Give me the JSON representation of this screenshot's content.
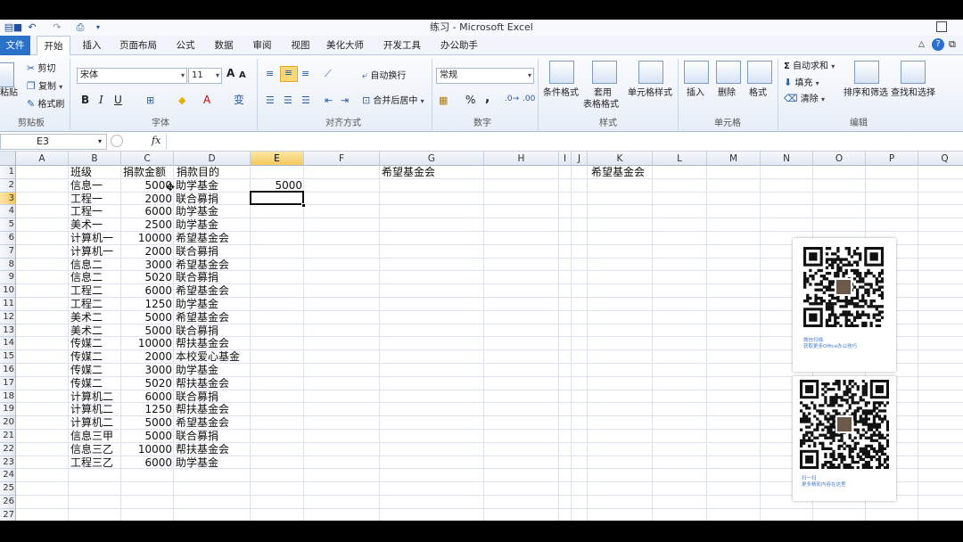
{
  "window": {
    "title": "练习 - Microsoft Excel",
    "restore_icon": "restore-window-icon"
  },
  "tabs": [
    "文件",
    "开始",
    "插入",
    "页面布局",
    "公式",
    "数据",
    "审阅",
    "视图",
    "美化大师",
    "开发工具",
    "办公助手"
  ],
  "ribbon": {
    "clipboard": {
      "paste": "粘贴",
      "cut": "剪切",
      "copy": "复制",
      "format_painter": "格式刷",
      "label": "剪贴板"
    },
    "font": {
      "name": "宋体",
      "size": "11",
      "label": "字体",
      "bold": "B",
      "italic": "I",
      "underline": "U",
      "grow": "A",
      "shrink": "A",
      "color_a": "A",
      "wen": "变"
    },
    "alignment": {
      "wrap": "自动换行",
      "merge": "合并后居中",
      "label": "对齐方式"
    },
    "number": {
      "format": "常规",
      "percent": "%",
      "comma": ",",
      "label": "数字"
    },
    "styles": {
      "conditional": "条件格式",
      "table": "套用",
      "table2": "表格格式",
      "cell_styles": "单元格样式",
      "label": "样式"
    },
    "cells": {
      "insert": "插入",
      "delete": "删除",
      "format": "格式",
      "label": "单元格"
    },
    "editing": {
      "autosum": "自动求和",
      "fill": "填充",
      "clear": "清除",
      "sort": "排序和筛选",
      "find": "查找和选择",
      "label": "编辑"
    }
  },
  "formula_bar": {
    "name_box": "E3",
    "fx": "fx",
    "formula": ""
  },
  "columns": [
    "A",
    "B",
    "C",
    "D",
    "E",
    "F",
    "G",
    "H",
    "I",
    "J",
    "K",
    "L",
    "M",
    "N",
    "O",
    "P",
    "Q"
  ],
  "rows": [
    "1",
    "2",
    "3",
    "4",
    "5",
    "6",
    "7",
    "8",
    "9",
    "10",
    "11",
    "12",
    "13",
    "14",
    "15",
    "16",
    "17",
    "18",
    "19",
    "20",
    "21",
    "22",
    "23",
    "24",
    "25",
    "26",
    "27"
  ],
  "header": {
    "class": "班级",
    "amount": "捐款金额",
    "purpose": "捐款目的"
  },
  "data": [
    [
      "信息一",
      "5000",
      "助学基金"
    ],
    [
      "工程一",
      "2000",
      "联合募捐"
    ],
    [
      "工程一",
      "6000",
      "助学基金"
    ],
    [
      "美术一",
      "2500",
      "助学基金"
    ],
    [
      "计算机一",
      "10000",
      "希望基金会"
    ],
    [
      "计算机一",
      "2000",
      "联合募捐"
    ],
    [
      "信息二",
      "3000",
      "希望基金会"
    ],
    [
      "信息二",
      "5020",
      "联合募捐"
    ],
    [
      "工程二",
      "6000",
      "希望基金会"
    ],
    [
      "工程二",
      "1250",
      "助学基金"
    ],
    [
      "美术二",
      "5000",
      "希望基金会"
    ],
    [
      "美术二",
      "5000",
      "联合募捐"
    ],
    [
      "传媒二",
      "10000",
      "帮扶基金会"
    ],
    [
      "传媒二",
      "2000",
      "本校爱心基金"
    ],
    [
      "传媒二",
      "3000",
      "助学基金"
    ],
    [
      "传媒二",
      "5020",
      "帮扶基金会"
    ],
    [
      "计算机二",
      "6000",
      "联合募捐"
    ],
    [
      "计算机二",
      "1250",
      "帮扶基金会"
    ],
    [
      "计算机二",
      "5000",
      "希望基金会"
    ],
    [
      "信息三甲",
      "5000",
      "联合募捐"
    ],
    [
      "信息三乙",
      "10000",
      "帮扶基金会"
    ],
    [
      "工程三乙",
      "6000",
      "助学基金"
    ]
  ],
  "extra": {
    "e2": "5000",
    "g1": "希望基金会",
    "k1": "希望基金会"
  },
  "qr": {
    "caption1a": "微信扫描",
    "caption1b": "获取更多Office办公技巧",
    "caption2a": "扫一扫",
    "caption2b": "更多精彩内容在这里"
  }
}
